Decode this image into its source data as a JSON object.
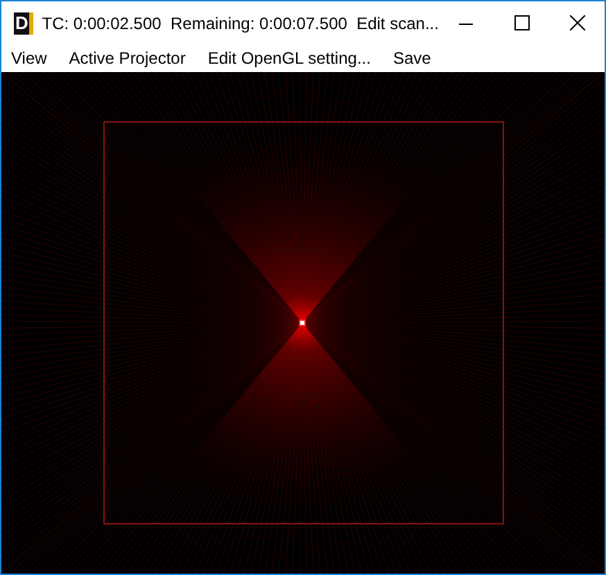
{
  "window": {
    "icon_letter": "D",
    "title": "TC: 0:00:02.500  Remaining: 0:00:07.500  Edit scan..."
  },
  "menu": [
    "View",
    "Active Projector",
    "Edit OpenGL setting...",
    "Save"
  ]
}
